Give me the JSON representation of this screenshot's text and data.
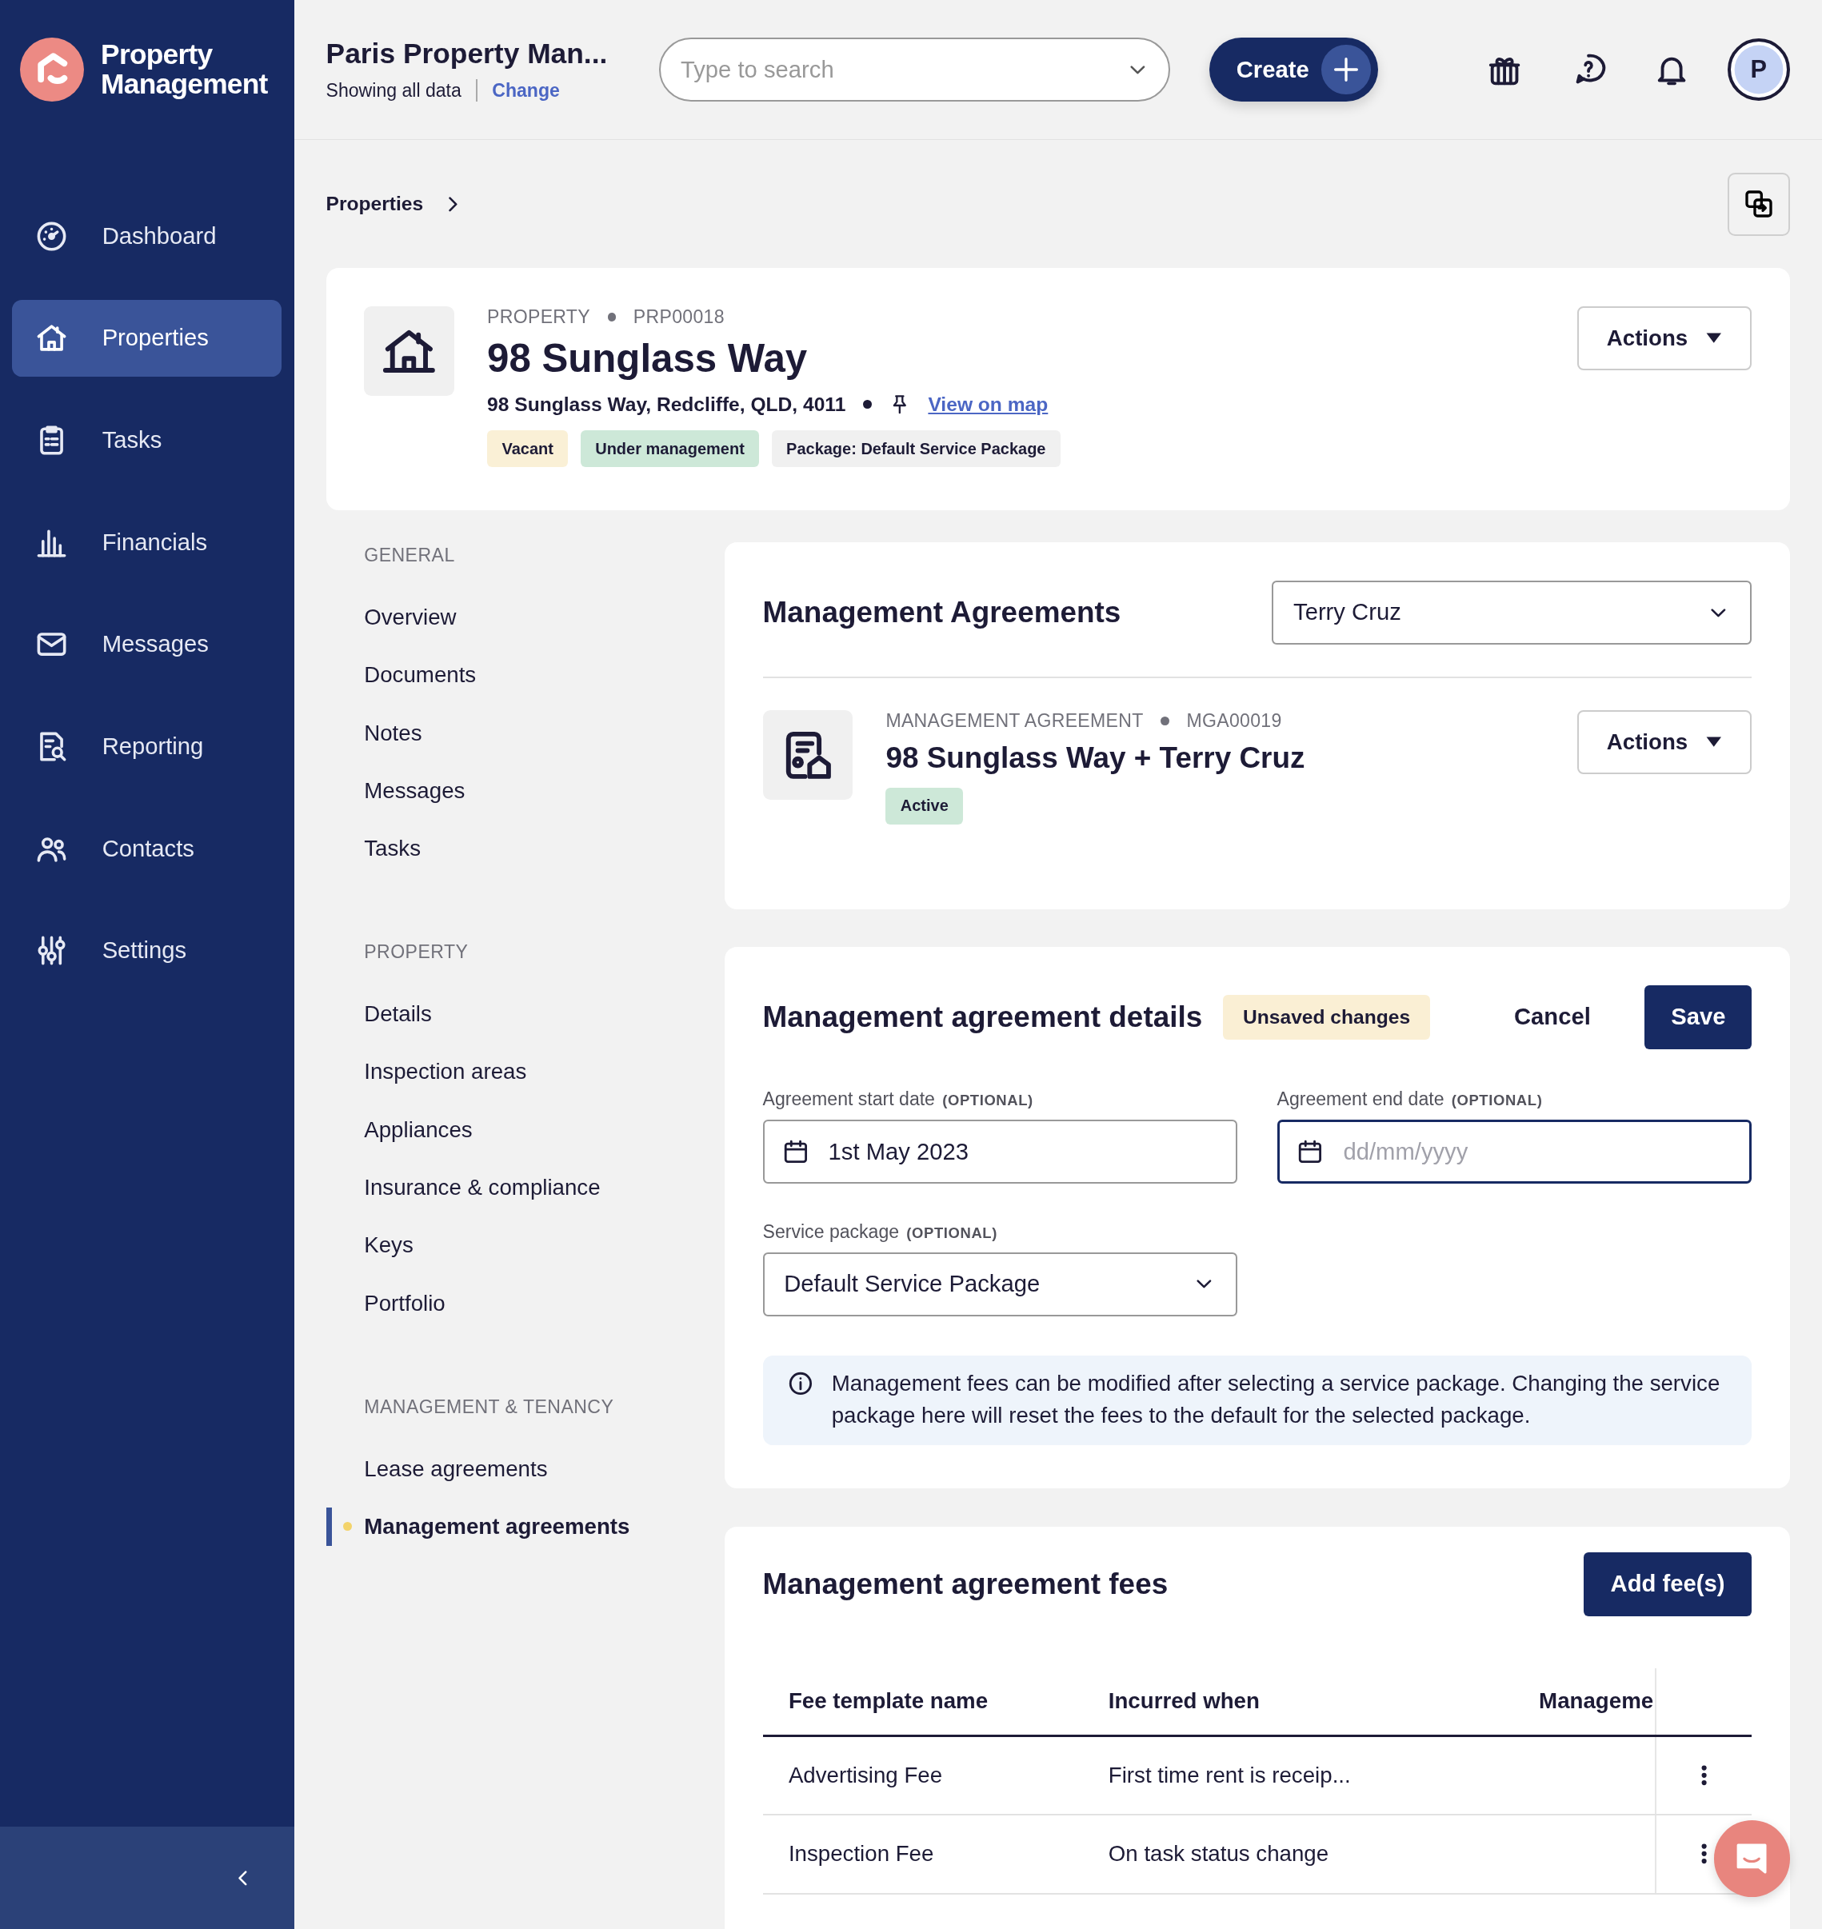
{
  "sidebar": {
    "logo_text": "Property Management",
    "items": [
      {
        "label": "Dashboard",
        "selected": false
      },
      {
        "label": "Properties",
        "selected": true
      },
      {
        "label": "Tasks",
        "selected": false
      },
      {
        "label": "Financials",
        "selected": false
      },
      {
        "label": "Messages",
        "selected": false
      },
      {
        "label": "Reporting",
        "selected": false
      },
      {
        "label": "Contacts",
        "selected": false
      },
      {
        "label": "Settings",
        "selected": false
      }
    ]
  },
  "topbar": {
    "org_title": "Paris Property Man...",
    "scope": "Showing all data",
    "change_link": "Change",
    "search": {
      "placeholder": "Type to search"
    },
    "create_button": "Create",
    "avatar": "P"
  },
  "breadcrumb": [
    "Properties"
  ],
  "property": {
    "category": "PROPERTY",
    "code": "PRP00018",
    "title": "98 Sunglass Way",
    "address": "98 Sunglass Way, Redcliffe, QLD, 4011",
    "map_link": "View on map",
    "tags": [
      {
        "label": "Vacant",
        "color": "#faf0d6"
      },
      {
        "label": "Under management",
        "color": "#cde8d8"
      },
      {
        "label": "Package: Default Service Package",
        "color": "#f0f0f0"
      }
    ],
    "actions_button": "Actions"
  },
  "section_nav": {
    "groups": [
      {
        "heading": "GENERAL",
        "items": [
          {
            "label": "Overview",
            "selected": false
          },
          {
            "label": "Documents",
            "selected": false
          },
          {
            "label": "Notes",
            "selected": false
          },
          {
            "label": "Messages",
            "selected": false
          },
          {
            "label": "Tasks",
            "selected": false
          }
        ]
      },
      {
        "heading": "PROPERTY",
        "items": [
          {
            "label": "Details",
            "selected": false
          },
          {
            "label": "Inspection areas",
            "selected": false
          },
          {
            "label": "Appliances",
            "selected": false
          },
          {
            "label": "Insurance & compliance",
            "selected": false
          },
          {
            "label": "Keys",
            "selected": false
          },
          {
            "label": "Portfolio",
            "selected": false
          }
        ]
      },
      {
        "heading": "MANAGEMENT & TENANCY",
        "items": [
          {
            "label": "Lease agreements",
            "selected": false
          },
          {
            "label": "Management agreements",
            "selected": true
          }
        ]
      }
    ]
  },
  "agreements": {
    "title": "Management Agreements",
    "owner_select": "Terry Cruz",
    "agreement": {
      "category": "MANAGEMENT AGREEMENT",
      "code": "MGA00019",
      "title": "98 Sunglass Way + Terry Cruz",
      "status": {
        "label": "Active",
        "color": "#cde8d8"
      },
      "actions_button": "Actions"
    }
  },
  "details": {
    "title": "Management agreement details",
    "badge": "Unsaved changes",
    "cancel_button": "Cancel",
    "save_button": "Save",
    "start_date": {
      "label": "Agreement start date",
      "optional_note": "(OPTIONAL)",
      "value": "1st May 2023",
      "focused": false
    },
    "end_date": {
      "label": "Agreement end date",
      "optional_note": "(OPTIONAL)",
      "placeholder": "dd/mm/yyyy",
      "focused": true
    },
    "service_package": {
      "label": "Service package",
      "optional_note": "(OPTIONAL)",
      "value": "Default Service Package"
    },
    "info_note": "Management fees can be modified after selecting a service package. Changing the service package here will reset the fees to the default for the selected package."
  },
  "fees": {
    "title": "Management agreement fees",
    "add_button": "Add fee(s)",
    "columns": [
      "Fee template name",
      "Incurred when",
      "Manageme"
    ],
    "rows": [
      {
        "name": "Advertising Fee",
        "incurred": "First time rent is receip..."
      },
      {
        "name": "Inspection Fee",
        "incurred": "On task status change"
      }
    ]
  }
}
